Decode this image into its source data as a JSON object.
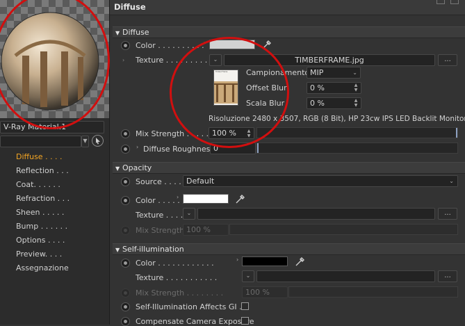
{
  "material_name": "V-Ray Material.1",
  "nav": {
    "items": [
      {
        "label": "Diffuse . . . .",
        "active": true
      },
      {
        "label": "Reflection . . .",
        "active": false
      },
      {
        "label": "Coat. . . . . .",
        "active": false
      },
      {
        "label": "Refraction . . .",
        "active": false
      },
      {
        "label": "Sheen . . . . .",
        "active": false
      },
      {
        "label": "Bump . . . . . .",
        "active": false
      },
      {
        "label": "Options . . . .",
        "active": false
      },
      {
        "label": "Preview. . . .",
        "active": false
      },
      {
        "label": "Assegnazione",
        "active": false
      }
    ]
  },
  "panel_title": "Diffuse",
  "diffuse": {
    "section_label": "Diffuse",
    "color_label": "Color . . . . . . . . . .",
    "color_value": "#d2d2d2",
    "texture_label": "Texture . . . . . . . . .",
    "texture_file": "TIMBERFRAME.jpg",
    "dots_button": "...",
    "thumbnail_caption": "Timber Frame",
    "sampling_label": "Campionamento",
    "sampling_value": "MIP",
    "offset_blur_label": "Offset Blur",
    "offset_blur_value": "0 %",
    "scale_blur_label": "Scala Blur",
    "scale_blur_value": "0 %",
    "resolution_info": "Risoluzione 2480 x 3507, RGB (8 Bit), HP 23cw IPS LED Backlit Monitor",
    "mix_strength_label": "Mix Strength . . . . .",
    "mix_strength_value": "100 %",
    "mix_strength_fraction": 1.0,
    "roughness_label": "Diffuse Roughness",
    "roughness_value": "0",
    "roughness_fraction": 0.0
  },
  "opacity": {
    "section_label": "Opacity",
    "source_label": "Source . . . . .",
    "source_value": "Default",
    "color_label": "Color . . . . .",
    "color_value": "#ffffff",
    "texture_label": "Texture . . . . .",
    "dots_button": "...",
    "mix_strength_label": "Mix Strength . . . .",
    "mix_strength_value": "100 %"
  },
  "self_illumination": {
    "section_label": "Self-illumination",
    "color_label": "Color . . . . . . . . . . . .",
    "color_value": "#000000",
    "texture_label": "Texture . . . . . . . . . . .",
    "dots_button": "...",
    "mix_strength_label": "Mix Strength . . . . . . . .",
    "mix_strength_value": "100 %",
    "affects_gi_label": "Self-Illumination Affects GI . .",
    "compensate_label": "Compensate Camera Exposure",
    "affects_gi_checked": false,
    "compensate_checked": false
  },
  "colors": {
    "accent": "#f5a623",
    "annotation": "#d10f0f"
  }
}
